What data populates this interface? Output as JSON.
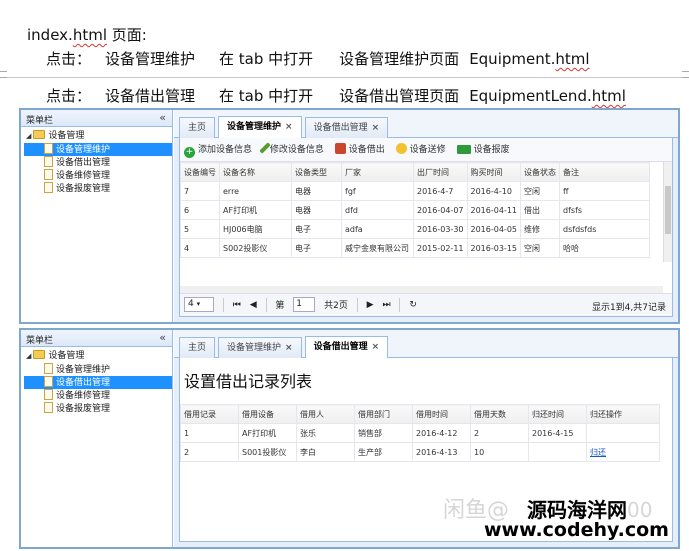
{
  "doc": {
    "line1_prefix": "index.",
    "line1_html": "html",
    "line1_suffix": " 页面:",
    "line2": {
      "label": "点击：",
      "item": "设备管理维护",
      "action": "在 tab 中打开",
      "target": "设备管理维护页面",
      "file_name": "Equipment.",
      "file_ext": "html"
    },
    "line3": {
      "label": "点击：",
      "item": "设备借出管理",
      "action": "在 tab 中打开",
      "target": "设备借出管理页面",
      "file_name": "EquipmentLend.",
      "file_ext": "html"
    }
  },
  "sidebar": {
    "title": "菜单栏",
    "collapse_icon": "«",
    "root": "设备管理",
    "items": [
      "设备管理维护",
      "设备借出管理",
      "设备维修管理",
      "设备报废管理"
    ]
  },
  "win1": {
    "tabs": [
      "主页",
      "设备管理维护",
      "设备借出管理"
    ],
    "close": "×",
    "toolbar": [
      "添加设备信息",
      "修改设备信息",
      "设备借出",
      "设备送修",
      "设备报废"
    ],
    "columns": [
      "设备编号",
      "设备名称",
      "设备类型",
      "厂家",
      "出厂时间",
      "购买时间",
      "设备状态",
      "备注"
    ],
    "rows": [
      [
        "7",
        "erre",
        "电器",
        "fgf",
        "2016-4-7",
        "2016-4-10",
        "空闲",
        "ff"
      ],
      [
        "6",
        "AF打印机",
        "电器",
        "dfd",
        "2016-04-07",
        "2016-04-11",
        "借出",
        "dfsfs"
      ],
      [
        "5",
        "HJ006电脑",
        "电子",
        "adfa",
        "2016-03-30",
        "2016-04-05",
        "维修",
        "dsfdsfds"
      ],
      [
        "4",
        "S002投影仪",
        "电子",
        "威宁金泉有限公司",
        "2015-02-11",
        "2016-03-15",
        "空闲",
        "哈哈"
      ]
    ],
    "pager": {
      "page_size": "4",
      "page_label": "第",
      "page_value": "1",
      "total_pages": "共2页",
      "summary": "显示1到4,共7记录"
    }
  },
  "win2": {
    "tabs": [
      "主页",
      "设备管理维护",
      "设备借出管理"
    ],
    "close": "×",
    "page_title": "设置借出记录列表",
    "columns": [
      "借用记录",
      "借用设备",
      "借用人",
      "借用部门",
      "借用时间",
      "借用天数",
      "归还时间",
      "归还操作"
    ],
    "rows": [
      [
        "1",
        "AF打印机",
        "张乐",
        "销售部",
        "2016-4-12",
        "2",
        "2016-4-15",
        ""
      ],
      [
        "2",
        "S001投影仪",
        "李白",
        "生产部",
        "2016-4-13",
        "10",
        "",
        "归还"
      ]
    ]
  },
  "watermark": {
    "text": "闲鱼@",
    "brand": "源码海洋网",
    "tail": "00",
    "url": "www.codehy.com"
  },
  "colors": {
    "selection": "#1e90ff",
    "border": "#7fa7cf",
    "link": "#1a56c4"
  }
}
